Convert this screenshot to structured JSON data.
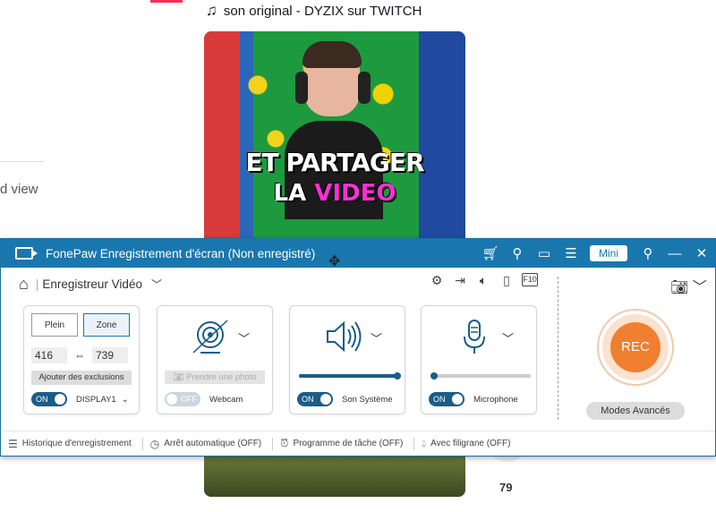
{
  "background": {
    "music_label": "son original - DYZIX sur TWITCH",
    "side_text": "d view",
    "caption_line1": "ET PARTAGER",
    "caption_line2_a": "LA ",
    "caption_line2_b": "VIDEO",
    "share_count": "79"
  },
  "recorder": {
    "window_title": "FonePaw Enregistrement d'écran (Non enregistré)",
    "mini_label": "Mini",
    "mode_label": "Enregistreur Vidéo",
    "f10_label": "F10",
    "screen": {
      "full_label": "Plein",
      "zone_label": "Zone",
      "width": "416",
      "height": "739",
      "exclusions_label": "Ajouter des exclusions",
      "toggle_label": "ON",
      "display_label": "DISPLAY1"
    },
    "webcam": {
      "photo_label": "Prendre une photo",
      "toggle_label": "OFF",
      "label": "Webcam"
    },
    "system_sound": {
      "toggle_label": "ON",
      "label": "Son Système",
      "level_percent": 100
    },
    "microphone": {
      "toggle_label": "ON",
      "label": "Microphone",
      "level_percent": 0
    },
    "rec_label": "REC",
    "advanced_label": "Modes Avancés",
    "footer": {
      "history": "Historique d'enregistrement",
      "auto_stop": "Arrêt automatique (OFF)",
      "schedule": "Programme de tâche (OFF)",
      "watermark": "Avec filigrane (OFF)"
    }
  },
  "colors": {
    "titlebar": "#1a77ae",
    "rec_button": "#f07f30",
    "toggle_on": "#1a5d87"
  }
}
